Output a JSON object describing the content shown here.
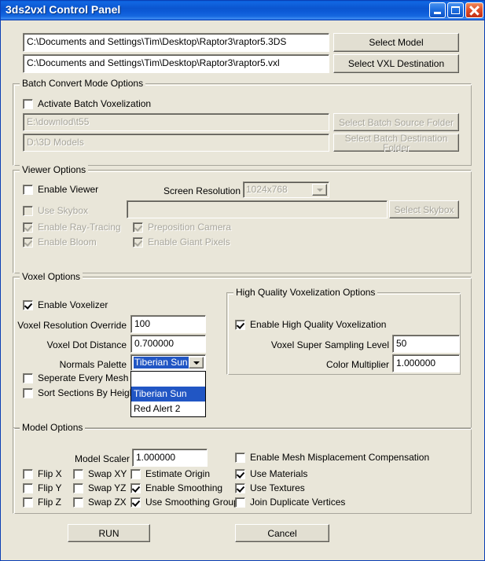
{
  "window": {
    "title": "3ds2vxl Control Panel",
    "accent_titlebar": "#0b56cf",
    "bg": "#e9e6d9",
    "highlight": "#2156c4",
    "caption": {
      "minimize": "minimize-icon",
      "maximize": "maximize-icon",
      "close": "close-icon"
    }
  },
  "paths": {
    "model_value": "C:\\Documents and Settings\\Tim\\Desktop\\Raptor3\\raptor5.3DS",
    "vxl_value": "C:\\Documents and Settings\\Tim\\Desktop\\Raptor3\\raptor5.vxl",
    "select_model_label": "Select Model",
    "select_vxl_label": "Select VXL Destination"
  },
  "batch": {
    "group_label": "Batch Convert Mode Options",
    "activate_label": "Activate Batch Voxelization",
    "activate_checked": false,
    "source_value": "E:\\downlod\\t55",
    "dest_value": "D:\\3D Models",
    "source_button": "Select Batch Source Folder",
    "dest_button": "Select Batch Destination Folder"
  },
  "viewer": {
    "group_label": "Viewer Options",
    "enable_viewer_label": "Enable Viewer",
    "enable_viewer_checked": false,
    "screen_resolution_label": "Screen Resolution",
    "screen_resolution_value": "1024x768",
    "use_skybox_label": "Use Skybox",
    "use_skybox_checked": false,
    "skybox_value": "",
    "select_skybox_label": "Select Skybox",
    "raytracing_label": "Enable Ray-Tracing",
    "raytracing_checked": true,
    "preposition_label": "Preposition Camera",
    "preposition_checked": true,
    "bloom_label": "Enable Bloom",
    "bloom_checked": true,
    "giant_pixels_label": "Enable Giant Pixels",
    "giant_pixels_checked": true
  },
  "voxel": {
    "group_label": "Voxel Options",
    "enable_voxelizer_label": "Enable Voxelizer",
    "enable_voxelizer_checked": true,
    "resolution_label": "Voxel Resolution Override",
    "resolution_value": "100",
    "dot_distance_label": "Voxel Dot Distance",
    "dot_distance_value": "0.700000",
    "normals_palette_label": "Normals Palette",
    "normals_palette_value": "Tiberian Sun",
    "normals_palette_options": [
      "",
      "Tiberian Sun",
      "Red Alert 2"
    ],
    "normals_palette_selected_index": 1,
    "separate_mesh_label": "Seperate Every Mesh",
    "separate_mesh_checked": false,
    "sort_sections_label": "Sort Sections By Height",
    "sort_sections_checked": false
  },
  "high_quality": {
    "group_label": "High Quality Voxelization Options",
    "enable_label": "Enable High Quality Voxelization",
    "enable_checked": true,
    "super_sampling_label": "Voxel Super Sampling Level",
    "super_sampling_value": "50",
    "color_multiplier_label": "Color Multiplier",
    "color_multiplier_value": "1.000000"
  },
  "model": {
    "group_label": "Model Options",
    "model_scaler_label": "Model Scaler",
    "model_scaler_value": "1.000000",
    "mesh_misplacement_label": "Enable Mesh Misplacement Compensation",
    "mesh_misplacement_checked": false,
    "flip": [
      {
        "label": "Flip X",
        "checked": false
      },
      {
        "label": "Flip Y",
        "checked": false
      },
      {
        "label": "Flip Z",
        "checked": false
      }
    ],
    "swap": [
      {
        "label": "Swap XY",
        "checked": false
      },
      {
        "label": "Swap YZ",
        "checked": false
      },
      {
        "label": "Swap ZX",
        "checked": false
      }
    ],
    "smoothing": [
      {
        "label": "Estimate Origin",
        "checked": false
      },
      {
        "label": "Enable Smoothing",
        "checked": true
      },
      {
        "label": "Use Smoothing Groups",
        "checked": true
      }
    ],
    "materials": [
      {
        "label": "Use Materials",
        "checked": true
      },
      {
        "label": "Use Textures",
        "checked": true
      },
      {
        "label": "Join Duplicate Vertices",
        "checked": false
      }
    ]
  },
  "actions": {
    "run_label": "RUN",
    "cancel_label": "Cancel"
  }
}
